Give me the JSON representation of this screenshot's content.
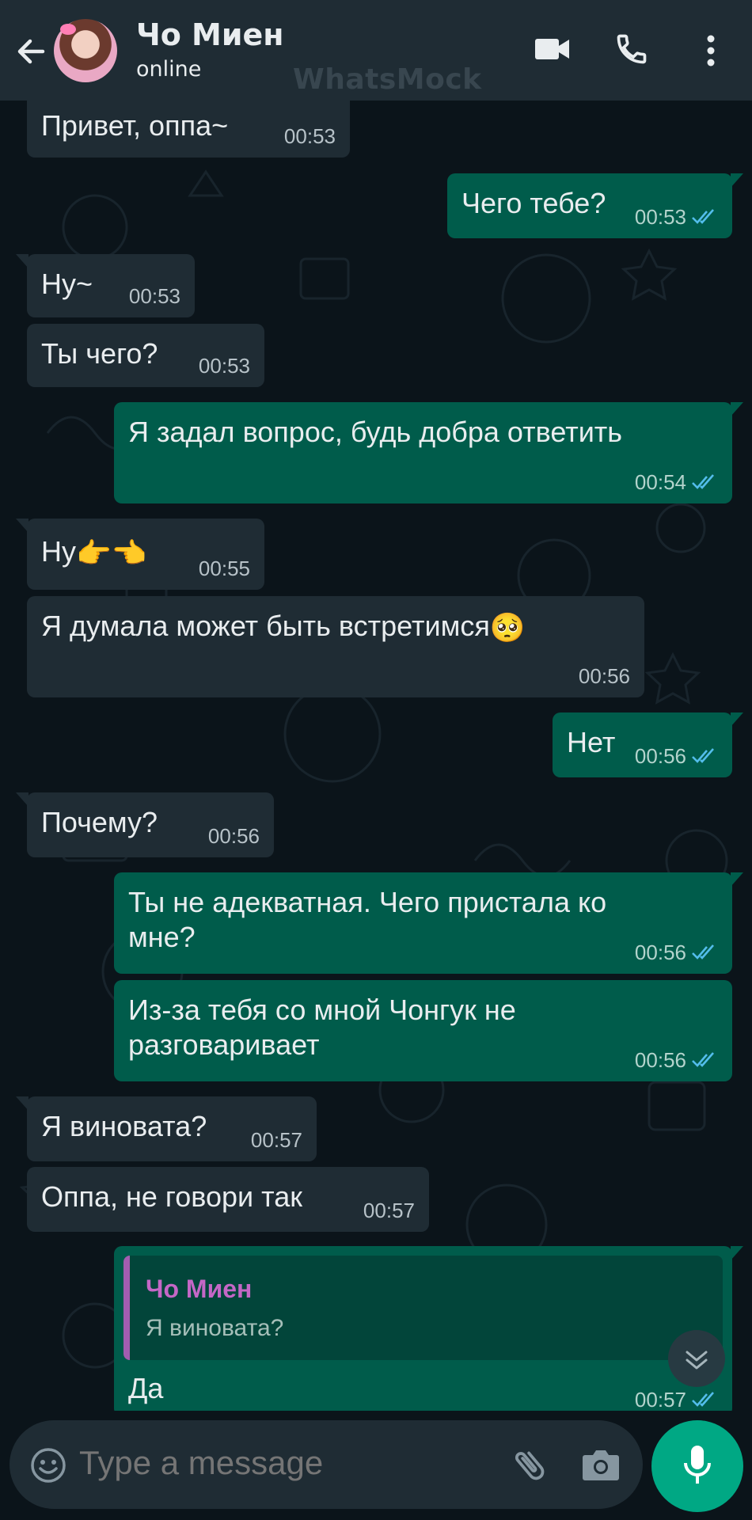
{
  "header": {
    "contact_name": "Чо Миен",
    "status": "online",
    "watermark": "WhatsMock"
  },
  "messages": [
    {
      "dir": "in",
      "text": "Привет, оппа~",
      "time": "00:53"
    },
    {
      "dir": "out",
      "text": "Чего тебе?",
      "time": "00:53"
    },
    {
      "dir": "in",
      "text": "Ну~",
      "time": "00:53"
    },
    {
      "dir": "in",
      "text": "Ты чего?",
      "time": "00:53"
    },
    {
      "dir": "out",
      "text": "Я задал вопрос, будь добра ответить",
      "time": "00:54"
    },
    {
      "dir": "in",
      "text": "Ну",
      "emoji": "👉👈",
      "time": "00:55"
    },
    {
      "dir": "in",
      "text": "Я думала может быть встретимся",
      "emoji": "🥺",
      "time": "00:56"
    },
    {
      "dir": "out",
      "text": "Нет",
      "time": "00:56"
    },
    {
      "dir": "in",
      "text": "Почему?",
      "time": "00:56"
    },
    {
      "dir": "out",
      "text": "Ты не адекватная. Чего пристала ко мне?",
      "time": "00:56"
    },
    {
      "dir": "out",
      "text": "Из-за тебя со мной Чонгук не разговаривает",
      "time": "00:56"
    },
    {
      "dir": "in",
      "text": "Я виновата?",
      "time": "00:57"
    },
    {
      "dir": "in",
      "text": "Оппа, не говори так",
      "time": "00:57"
    },
    {
      "dir": "out",
      "text": "Да",
      "time": "00:57",
      "reply": {
        "name": "Чо Миен",
        "text": "Я виновата?"
      }
    }
  ],
  "composer": {
    "placeholder": "Type a message"
  },
  "icons": {
    "back": "arrow-left-icon",
    "video": "video-call-icon",
    "call": "phone-icon",
    "menu": "more-vertical-icon",
    "emoji": "emoji-icon",
    "attach": "paperclip-icon",
    "camera": "camera-icon",
    "mic": "mic-icon",
    "scroll": "chevron-down-icon"
  },
  "colors": {
    "header_bg": "#1f2c34",
    "chat_bg": "#0b141a",
    "incoming_bubble": "#1f2c34",
    "outgoing_bubble": "#005c4b",
    "read_ticks": "#53bdeb",
    "mic_button": "#00a884",
    "quote_name": "#c467c6"
  }
}
